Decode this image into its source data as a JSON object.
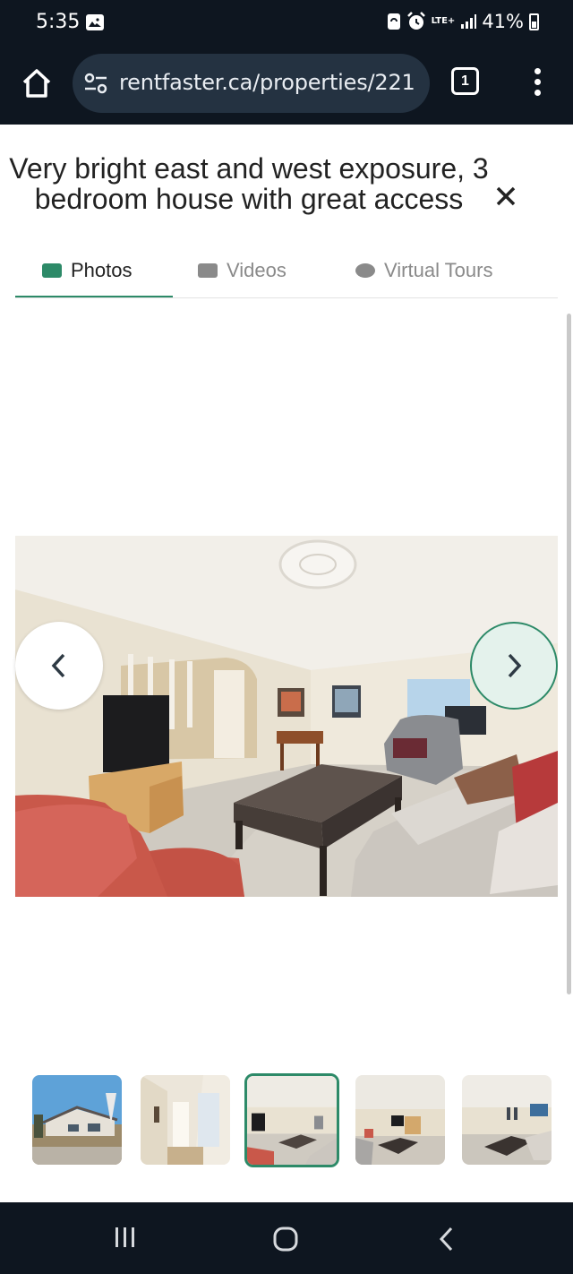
{
  "status_bar": {
    "time": "5:35",
    "network": "LTE+",
    "battery": "41%",
    "icons": [
      "gallery-icon",
      "sync-icon",
      "alarm-icon",
      "signal-icon",
      "battery-icon"
    ]
  },
  "browser": {
    "url": "rentfaster.ca/properties/221",
    "tab_count": "1"
  },
  "listing": {
    "title": "Very bright east and west exposure, 3 bedroom house with great access"
  },
  "media_tabs": [
    {
      "label": "Photos",
      "icon": "photo-icon",
      "active": true
    },
    {
      "label": "Videos",
      "icon": "video-icon",
      "active": false
    },
    {
      "label": "Virtual Tours",
      "icon": "vr-icon",
      "active": false
    }
  ],
  "gallery": {
    "current_photo": "living-room",
    "thumbnails": [
      {
        "subject": "house-exterior",
        "active": false
      },
      {
        "subject": "hallway",
        "active": false
      },
      {
        "subject": "living-room",
        "active": true
      },
      {
        "subject": "living-room-alt",
        "active": false
      },
      {
        "subject": "living-room-wide",
        "active": false
      }
    ]
  },
  "colors": {
    "accent": "#2d8a68",
    "chrome": "#0e1620",
    "url_pill": "#243241"
  }
}
